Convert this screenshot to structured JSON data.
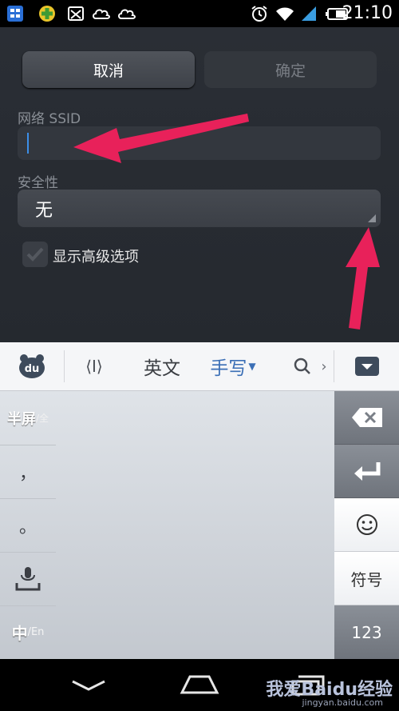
{
  "status_bar": {
    "time": "21:10",
    "left_icons": [
      "app-grid-icon",
      "puzzle-icon",
      "cat-face-icon",
      "cloud-icon",
      "cloud-icon"
    ],
    "right_icons": [
      "alarm-clock-icon",
      "wifi-icon",
      "signal-icon",
      "battery-icon"
    ]
  },
  "dialog": {
    "cancel_label": "取消",
    "ok_label": "确定",
    "ssid_label": "网络 SSID",
    "ssid_value": "",
    "security_label": "安全性",
    "security_value": "无",
    "advanced_label": "显示高级选项",
    "advanced_checked": false
  },
  "keyboard": {
    "toolbar": {
      "logo": "du",
      "cursor_icon": "⟨I⟩",
      "english": "英文",
      "handwrite": "手写",
      "search_icon": "search-icon",
      "more": "›",
      "hide_icon": "keyboard-hide-icon"
    },
    "left_keys": {
      "half_width_main": "半屏",
      "half_width_sub": "/全",
      "comma": "，",
      "period": "。",
      "lang_main": "中",
      "lang_sub": "/En"
    },
    "right_keys": {
      "symbols": "符号",
      "numbers": "123"
    },
    "accent": "#3b6fb6"
  },
  "watermark": {
    "text": "我爱Baidu经验",
    "sub": "jingyan.baidu.com"
  }
}
